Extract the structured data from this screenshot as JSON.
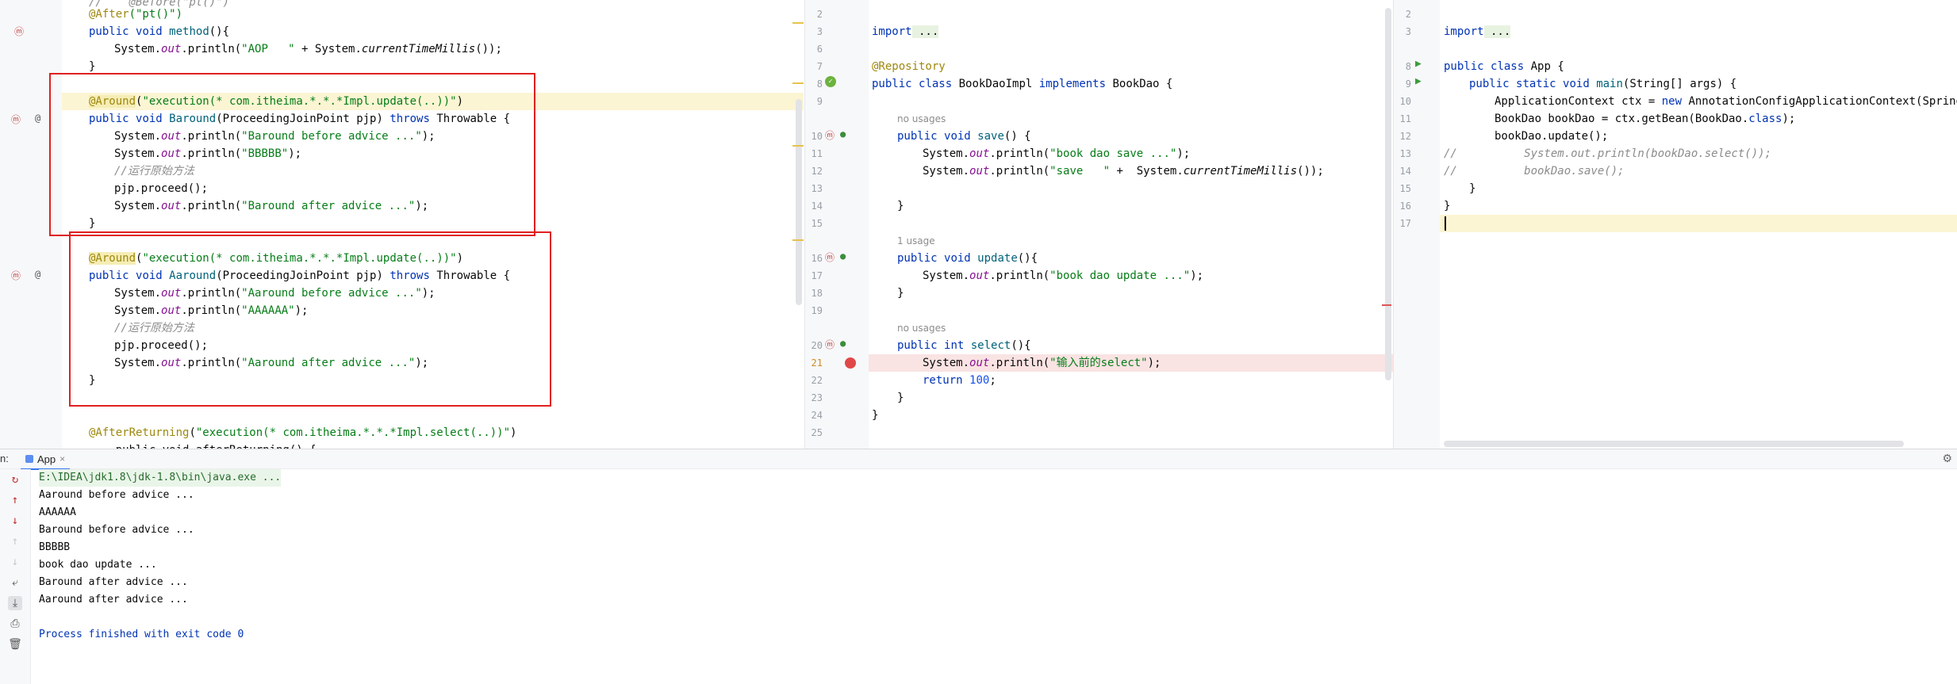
{
  "left_editor": {
    "lines": [
      {
        "k": "raw",
        "t": "//    @Before(\"pt()\")"
      },
      {
        "k": "ann",
        "t": "@After(\"pt()\")"
      },
      {
        "k": "sig1",
        "t": "method"
      },
      {
        "k": "aop",
        "t": "System.out.println(\"AOP   \" + System.currentTimeMillis());"
      },
      {
        "k": "close",
        "t": "}"
      },
      {
        "k": "blank",
        "t": ""
      },
      {
        "k": "around",
        "t": "@Around(\"execution(* com.itheima.*.*.*Impl.update(..))\")"
      },
      {
        "k": "sigB",
        "t": "public void Baround(ProceedingJoinPoint pjp) throws Throwable {"
      },
      {
        "k": "p",
        "t": "System.out.println(\"Baround before advice ...\");"
      },
      {
        "k": "p",
        "t": "System.out.println(\"BBBBB\");"
      },
      {
        "k": "cm",
        "t": "//运行原始方法"
      },
      {
        "k": "pr",
        "t": "pjp.proceed();"
      },
      {
        "k": "p",
        "t": "System.out.println(\"Baround after advice ...\");"
      },
      {
        "k": "close",
        "t": "}"
      },
      {
        "k": "blank",
        "t": ""
      },
      {
        "k": "around",
        "t": "@Around(\"execution(* com.itheima.*.*.*Impl.update(..))\")"
      },
      {
        "k": "sigA",
        "t": "public void Aaround(ProceedingJoinPoint pjp) throws Throwable {"
      },
      {
        "k": "p",
        "t": "System.out.println(\"Aaround before advice ...\");"
      },
      {
        "k": "p",
        "t": "System.out.println(\"AAAAAA\");"
      },
      {
        "k": "cm",
        "t": "//运行原始方法"
      },
      {
        "k": "pr",
        "t": "pjp.proceed();"
      },
      {
        "k": "p",
        "t": "System.out.println(\"Aaround after advice ...\");"
      },
      {
        "k": "close",
        "t": "}"
      },
      {
        "k": "blank",
        "t": ""
      },
      {
        "k": "blank",
        "t": ""
      },
      {
        "k": "afret",
        "t": "@AfterReturning(\"execution(* com.itheima.*.*.*Impl.select(..))\")"
      }
    ],
    "labels": {
      "after_ann": "@After",
      "after_arg": "(\"pt()\")",
      "public": "public",
      "void": "void",
      "method": "method",
      "method_tail": "(){",
      "system": "System.",
      "out": "out",
      "println_open": ".println(",
      "aop_str": "\"AOP   \"",
      "aop_plus": " + System.",
      "ctm": "currentTimeMillis",
      "ctm_tail": "());",
      "around_ann": "@Around",
      "around_arg_open": "(",
      "around_str": "\"execution(* com.itheima.*.*.*Impl.update(..))\"",
      "around_close": ")",
      "baround": "Baround",
      "aaround": "Aaround",
      "sig_params": "(ProceedingJoinPoint pjp) ",
      "throws": "throws",
      "throwable": " Throwable {",
      "b_before": "\"Baround before advice ...\"",
      "bbbbb": "\"BBBBB\"",
      "b_after": "\"Baround after advice ...\"",
      "a_before": "\"Aaround before advice ...\"",
      "aaaaaa": "\"AAAAAA\"",
      "a_after": "\"Aaround after advice ...\"",
      "close_stmt": ");",
      "comment": "//运行原始方法",
      "proceed": "pjp.proceed();",
      "brace": "}",
      "afret_ann": "@AfterReturning",
      "afret_str": "\"execution(* com.itheima.*.*.*Impl.select(..))\"",
      "partial": "    public void afterReturning() {"
    }
  },
  "middle_editor": {
    "line_numbers": [
      "2",
      "3",
      "6",
      "7",
      "8",
      "9",
      "",
      "10",
      "11",
      "12",
      "13",
      "14",
      "15",
      "",
      "16",
      "17",
      "18",
      "19",
      "",
      "20",
      "21",
      "22",
      "23",
      "24",
      "25"
    ],
    "code": {
      "import_kw": "import",
      "import_dots": " ...",
      "repository": "@Repository",
      "class_decl_public": "public",
      "class_decl_class": "class",
      "class_name": " BookDaoImpl ",
      "implements": "implements",
      "bookdao": " BookDao {",
      "no_usages": "no usages",
      "one_usage": "1 usage",
      "save": "save",
      "save_tail": "() {",
      "save_str": "\"book dao save ...\"",
      "save2_str": "\"save   \"",
      "save2_tail": " +  System.",
      "update": "update",
      "update_tail": "(){",
      "update_str": "\"book dao update ...\"",
      "int": "int",
      "select": "select",
      "select_str": "\"输入前的select\"",
      "return": "return",
      "hundred": "100",
      "semi": ";",
      "close": "}"
    }
  },
  "right_editor": {
    "line_numbers": [
      "2",
      "3",
      "8",
      "9",
      "10",
      "11",
      "12",
      "13",
      "14",
      "15",
      "16",
      "17"
    ],
    "code": {
      "import_kw": "import",
      "import_dots": " ...",
      "public": "public",
      "class": "class",
      "app": " App {",
      "static": "static",
      "void": "void",
      "main": "main",
      "main_tail": "(String[] args) {",
      "ctx_decl": "ApplicationContext ctx = ",
      "new": "new",
      "ctx_tail": " AnnotationConfigApplicationContext(SpringConfig.class);",
      "bookdao_decl": "BookDao bookDao = ctx.getBean(BookDao.",
      "class_kw": "class",
      "bookdao_tail": ");",
      "update_call": "bookDao.update();",
      "c1": "//          System.out.println(bookDao.select());",
      "c2": "//          bookDao.save();",
      "close_inner": "}",
      "close_outer": "}"
    }
  },
  "run_panel": {
    "prefix": "n:",
    "tab_label": "App",
    "close_glyph": "×",
    "settings_icon": "⚙",
    "console": [
      "E:\\IDEA\\jdk1.8\\jdk-1.8\\bin\\java.exe ...",
      "Aaround before advice ...",
      "AAAAAA",
      "Baround before advice ...",
      "BBBBB",
      "book dao update ...",
      "Baround after advice ...",
      "Aaround after advice ...",
      "",
      "Process finished with exit code 0"
    ]
  },
  "colors": {
    "accent_red": "#e02020",
    "keyword": "#0033b3",
    "string": "#067d17",
    "annotation": "#9e880d"
  }
}
